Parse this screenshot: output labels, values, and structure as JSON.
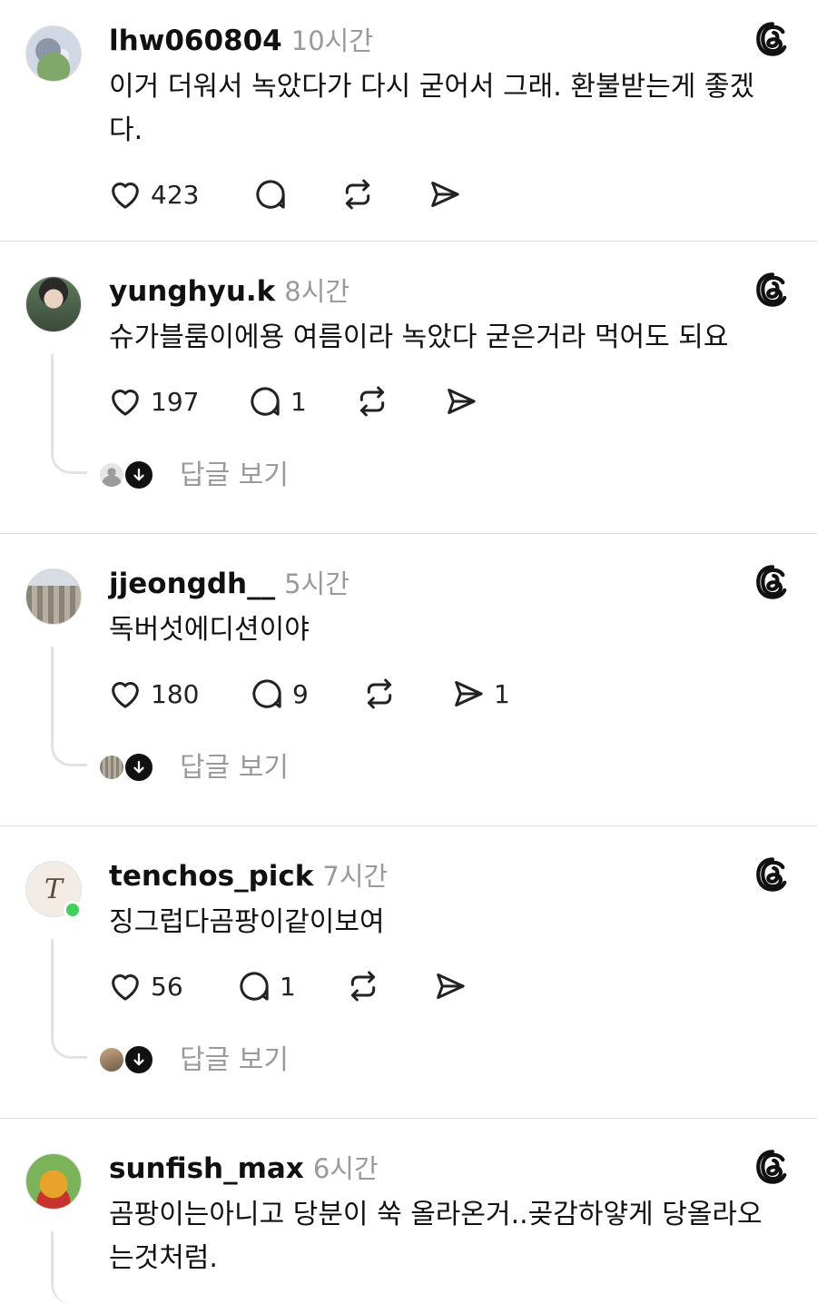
{
  "posts": [
    {
      "username": "lhw060804",
      "time": "10시간",
      "avatar": "totoro-avatar",
      "text": "이거 더워서 녹았다가 다시 굳어서 그래. 환불받는게 좋겠다.",
      "likes": "423",
      "comments": "",
      "reposts": "",
      "shares": "",
      "replies_label": ""
    },
    {
      "username": "yunghyu.k",
      "time": "8시간",
      "avatar": "person-avatar",
      "text": "슈가블룸이에용 여름이라 녹았다 굳은거라 먹어도 되요",
      "likes": "197",
      "comments": "1",
      "reposts": "",
      "shares": "",
      "replies_label": "답글 보기"
    },
    {
      "username": "jjeongdh__",
      "time": "5시간",
      "avatar": "colosseum-avatar",
      "text": "독버섯에디션이야",
      "likes": "180",
      "comments": "9",
      "reposts": "",
      "shares": "1",
      "replies_label": "답글 보기"
    },
    {
      "username": "tenchos_pick",
      "time": "7시간",
      "avatar": "letter-avatar",
      "avatar_letter": "T",
      "text": "징그럽다곰팡이같이보여",
      "likes": "56",
      "comments": "1",
      "reposts": "",
      "shares": "",
      "replies_label": "답글 보기"
    },
    {
      "username": "sunfish_max",
      "time": "6시간",
      "avatar": "pooh-avatar",
      "text": "곰팡이는아니고 당분이 쑥 올라온거..곶감하얗게 당올라오는것처럼.",
      "likes": "",
      "comments": "",
      "reposts": "",
      "shares": "",
      "replies_label": ""
    }
  ],
  "icons": {
    "like": "heart-icon",
    "comment": "comment-bubble-icon",
    "repost": "repost-icon",
    "share": "send-icon",
    "brand": "threads-logo-icon",
    "expand": "arrow-down-icon"
  },
  "colors": {
    "text": "#111111",
    "muted": "#9a9a9a",
    "divider": "#dcdcdc",
    "online": "#3dd15a"
  }
}
